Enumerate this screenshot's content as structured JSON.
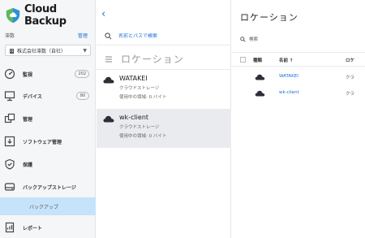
{
  "app": {
    "name": "Cloud Backup"
  },
  "tenant": {
    "label": "滞数",
    "manage": "管理",
    "selected": "株式会社滞数（自社）"
  },
  "sidebar": {
    "items": [
      {
        "label": "監視",
        "badge": "202",
        "icon": "dashboard-icon"
      },
      {
        "label": "デバイス",
        "badge": "80",
        "icon": "monitor-icon"
      },
      {
        "label": "管理",
        "icon": "management-icon"
      },
      {
        "label": "ソフトウェア管理",
        "icon": "software-icon"
      },
      {
        "label": "保護",
        "icon": "shield-icon"
      },
      {
        "label": "バックアップストレージ",
        "icon": "storage-icon"
      },
      {
        "label": "レポート",
        "icon": "report-icon"
      }
    ],
    "sub_item": "バックアップ"
  },
  "middle": {
    "search_placeholder": "名前とパスで検索",
    "section_title": "ロケーション",
    "locations": [
      {
        "name": "WATAKEI",
        "type": "クラウドストレージ",
        "usage": "使用中の領域: 0 バイト"
      },
      {
        "name": "wk-client",
        "type": "クラウドストレージ",
        "usage": "使用中の領域: 0 バイト"
      }
    ]
  },
  "right": {
    "heading": "ロケーション",
    "search_label": "検索",
    "columns": {
      "type": "種類",
      "name": "名前 ↑",
      "location": "ロケ"
    },
    "rows": [
      {
        "name": "WATAKEI",
        "location": "クラ"
      },
      {
        "name": "wk-client",
        "location": "クラ"
      }
    ]
  },
  "colors": {
    "accent": "#1a6fd6",
    "selected_sub": "#c5e3fa",
    "cloud_icon": "#2b2f36"
  }
}
